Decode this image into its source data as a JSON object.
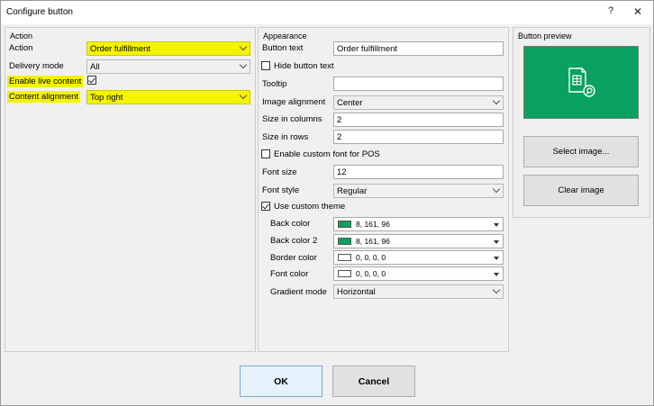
{
  "window": {
    "title": "Configure button",
    "help_label": "?",
    "close_label": "✕"
  },
  "action": {
    "group_title": "Action",
    "action_label": "Action",
    "action_value": "Order fulfillment",
    "delivery_label": "Delivery mode",
    "delivery_value": "All",
    "live_content_label": "Enable live content",
    "live_content_checked": true,
    "content_alignment_label": "Content alignment",
    "content_alignment_value": "Top right",
    "highlight_color": "#f4f400"
  },
  "appearance": {
    "group_title": "Appearance",
    "button_text_label": "Button text",
    "button_text_value": "Order fulfillment",
    "hide_text_label": "Hide button text",
    "tooltip_label": "Tooltip",
    "tooltip_value": "",
    "image_alignment_label": "Image alignment",
    "image_alignment_value": "Center",
    "columns_label": "Size in columns",
    "columns_value": "2",
    "rows_label": "Size in rows",
    "rows_value": "2",
    "custom_font_label": "Enable custom font for POS",
    "font_size_label": "Font size",
    "font_size_value": "12",
    "font_style_label": "Font style",
    "font_style_value": "Regular",
    "custom_theme_label": "Use custom theme",
    "back_color_label": "Back color",
    "back_color_value": "8, 161, 96",
    "back_color2_label": "Back color 2",
    "back_color2_value": "8, 161, 96",
    "border_color_label": "Border color",
    "border_color_value": "0, 0, 0, 0",
    "font_color_label": "Font color",
    "font_color_value": "0, 0, 0, 0",
    "gradient_label": "Gradient mode",
    "gradient_value": "Horizontal",
    "theme_swatch_color": "#08a160"
  },
  "preview": {
    "group_title": "Button preview",
    "select_image_label": "Select image...",
    "clear_image_label": "Clear image",
    "preview_color": "#08a160",
    "icon": "order-search-icon"
  },
  "footer": {
    "ok_label": "OK",
    "cancel_label": "Cancel"
  }
}
